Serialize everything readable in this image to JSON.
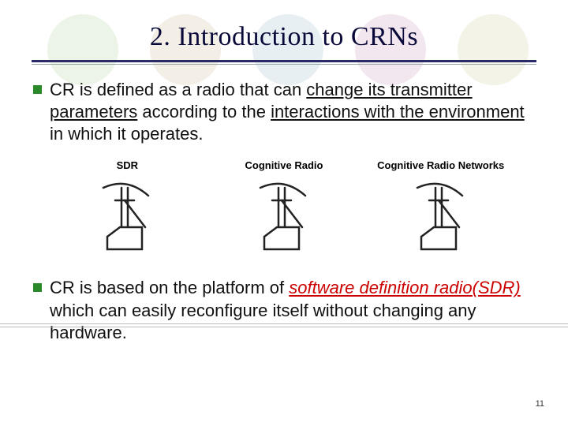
{
  "title": "2. Introduction to CRNs",
  "bullet1": {
    "prefix": "CR is defined as a radio that can ",
    "underline1": "change its transmitter parameters",
    "mid": " according to the ",
    "underline2": "interactions with the environment",
    "suffix": " in which it operates."
  },
  "labels": {
    "sdr": "SDR",
    "cr": "Cognitive Radio",
    "crn": "Cognitive Radio Networks"
  },
  "bullet2": {
    "prefix": "CR is based on the platform of ",
    "italic": "software definition radio(SDR)",
    "suffix": " which can easily reconfigure itself without changing any hardware."
  },
  "page_number": "11",
  "deco_colors": [
    "#d9e8d0",
    "#e8e0d0",
    "#d0e0e8",
    "#e8d0e0",
    "#e8e8d0"
  ]
}
